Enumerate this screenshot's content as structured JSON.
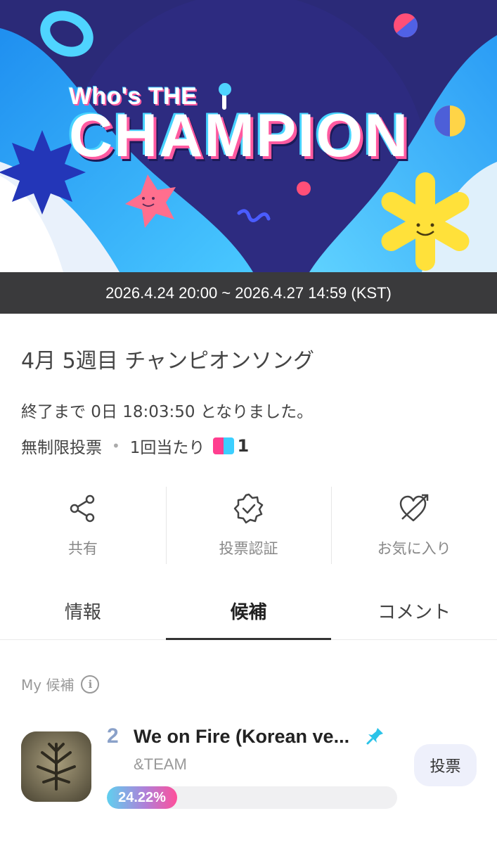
{
  "banner": {
    "title_small": "Who's THE",
    "title_big": "CHAMPION",
    "period": "2026.4.24 20:00 ~ 2026.4.27 14:59 (KST)"
  },
  "vote": {
    "title": "4月 5週目 チャンピオンソング",
    "countdown": "終了まで 0日 18:03:50 となりました。",
    "rule": "無制限投票",
    "separator": "•",
    "per_vote": "1回当たり",
    "cost": "1"
  },
  "actions": [
    {
      "label": "共有",
      "icon": "share-icon"
    },
    {
      "label": "投票認証",
      "icon": "verified-badge-icon"
    },
    {
      "label": "お気に入り",
      "icon": "heart-arrow-icon"
    }
  ],
  "tabs": [
    {
      "label": "情報",
      "active": false
    },
    {
      "label": "候補",
      "active": true
    },
    {
      "label": "コメント",
      "active": false
    }
  ],
  "my_candidates": {
    "label": "My 候補",
    "info_symbol": "i"
  },
  "candidate": {
    "rank": "2",
    "title": "We on Fire (Korean ve...",
    "artist": "&TEAM",
    "percent_text": "24.22%",
    "percent_value": 24.22,
    "vote_label": "投票"
  },
  "colors": {
    "banner_bg": "#2a2877",
    "accent_blue": "#3ccfff",
    "accent_pink": "#ff4f9a",
    "period_bar": "#3a3a3c"
  }
}
